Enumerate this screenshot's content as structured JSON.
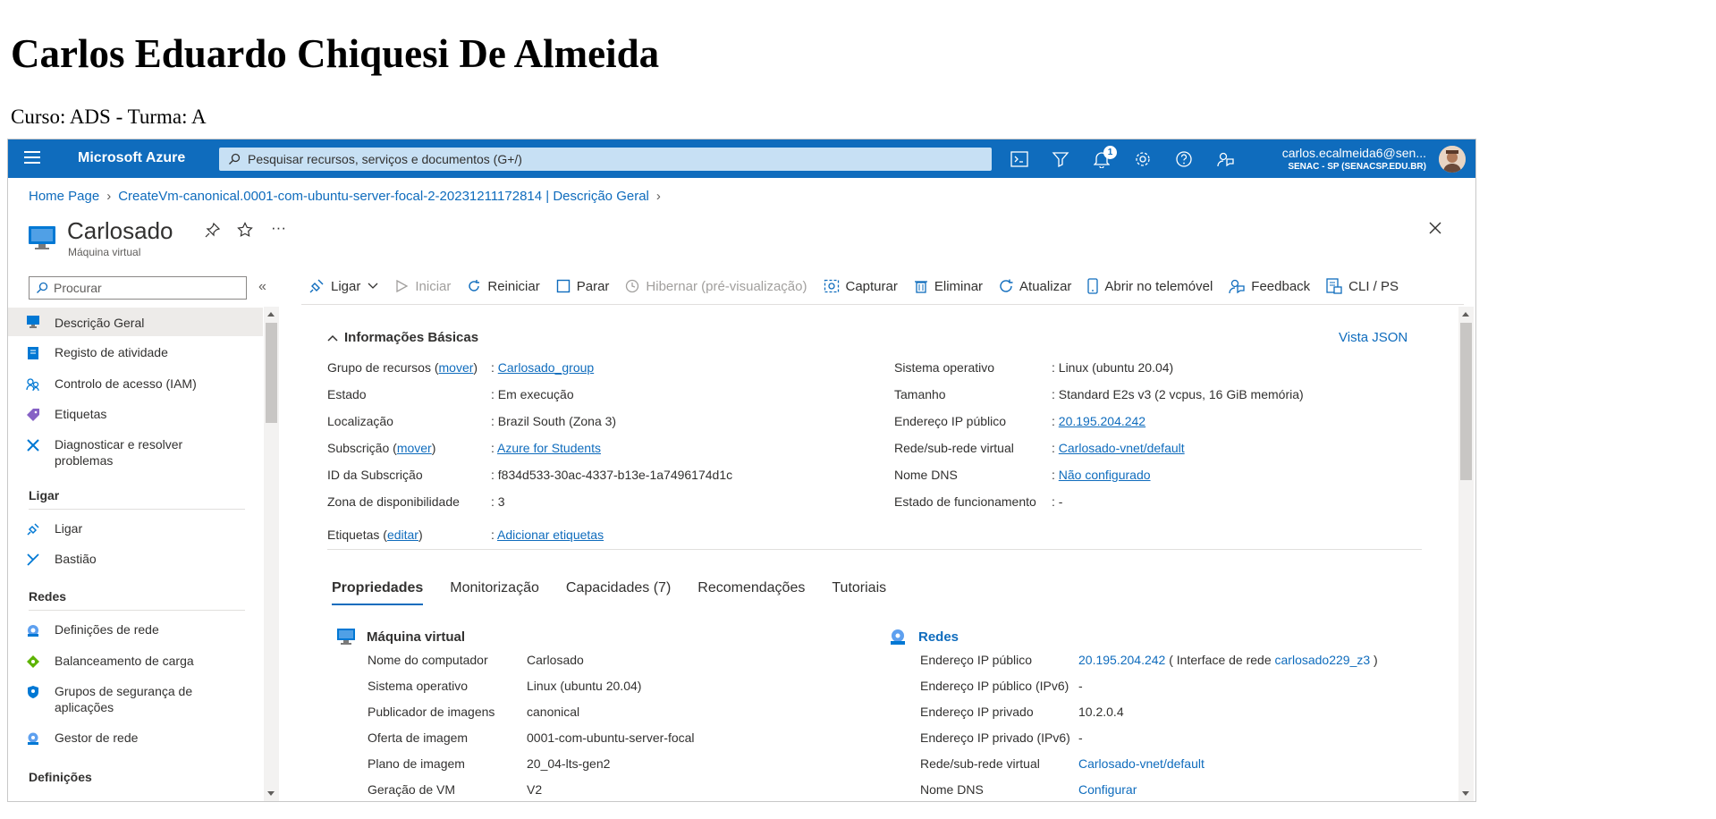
{
  "page": {
    "heading": "Carlos Eduardo Chiquesi De Almeida",
    "subheading": "Curso: ADS - Turma: A"
  },
  "topbar": {
    "brand": "Microsoft Azure",
    "search_placeholder": "Pesquisar recursos, serviços e documentos (G+/)",
    "notifications_count": "1",
    "account_email": "carlos.ecalmeida6@sen...",
    "account_tenant": "SENAC - SP (SENACSP.EDU.BR)"
  },
  "breadcrumb": {
    "items": [
      "Home Page",
      "CreateVm-canonical.0001-com-ubuntu-server-focal-2-20231211172814 | Descrição Geral"
    ]
  },
  "resource": {
    "name": "Carlosado",
    "type": "Máquina virtual"
  },
  "sidebar": {
    "search_placeholder": "Procurar",
    "items": [
      {
        "label": "Descrição Geral",
        "icon": "vm-monitor-icon",
        "active": true
      },
      {
        "label": "Registo de atividade",
        "icon": "activity-log-icon"
      },
      {
        "label": "Controlo de acesso (IAM)",
        "icon": "people-icon"
      },
      {
        "label": "Etiquetas",
        "icon": "tag-icon"
      },
      {
        "label": "Diagnosticar e resolver problemas",
        "icon": "wrench-icon"
      }
    ],
    "group_ligar": "Ligar",
    "ligar_items": [
      {
        "label": "Ligar",
        "icon": "plug-icon"
      },
      {
        "label": "Bastião",
        "icon": "bastion-icon"
      }
    ],
    "group_redes": "Redes",
    "redes_items": [
      {
        "label": "Definições de rede",
        "icon": "network-icon"
      },
      {
        "label": "Balanceamento de carga",
        "icon": "load-balancer-icon"
      },
      {
        "label": "Grupos de segurança de aplicações",
        "icon": "shield-icon"
      },
      {
        "label": "Gestor de rede",
        "icon": "network-manager-icon"
      }
    ],
    "group_definicoes": "Definições"
  },
  "commands": {
    "ligar": "Ligar",
    "iniciar": "Iniciar",
    "reiniciar": "Reiniciar",
    "parar": "Parar",
    "hibernar": "Hibernar (pré-visualização)",
    "capturar": "Capturar",
    "eliminar": "Eliminar",
    "atualizar": "Atualizar",
    "abrir": "Abrir no telemóvel",
    "feedback": "Feedback",
    "cli": "CLI / PS"
  },
  "essentials": {
    "toggle_label": "Informações Básicas",
    "json_link": "Vista JSON",
    "move_link": "mover",
    "edit_link": "editar",
    "left": {
      "grupo_label_pre": "Grupo de recursos (",
      "grupo_label_post": ")",
      "grupo_value": "Carlosado_group",
      "estado_label": "Estado",
      "estado_value": "Em execução",
      "localizacao_label": "Localização",
      "localizacao_value": "Brazil South (Zona 3)",
      "subscricao_label_pre": "Subscrição (",
      "subscricao_label_post": ")",
      "subscricao_value": "Azure for Students",
      "id_label": "ID da Subscrição",
      "id_value": "f834d533-30ac-4337-b13e-1a7496174d1c",
      "zona_label": "Zona de disponibilidade",
      "zona_value": "3"
    },
    "right": {
      "so_label": "Sistema operativo",
      "so_value": "Linux (ubuntu 20.04)",
      "tamanho_label": "Tamanho",
      "tamanho_value": "Standard E2s v3 (2 vcpus, 16 GiB memória)",
      "ip_label": "Endereço IP público",
      "ip_value": "20.195.204.242",
      "vnet_label": "Rede/sub-rede virtual",
      "vnet_value": "Carlosado-vnet/default",
      "dns_label": "Nome DNS",
      "dns_value": "Não configurado",
      "health_label": "Estado de funcionamento",
      "health_value": "-"
    },
    "tags_label_pre": "Etiquetas (",
    "tags_label_post": ")",
    "tags_value": "Adicionar etiquetas"
  },
  "tabs": [
    "Propriedades",
    "Monitorização",
    "Capacidades (7)",
    "Recomendações",
    "Tutoriais"
  ],
  "vm_section": {
    "title": "Máquina virtual",
    "rows": [
      {
        "label": "Nome do computador",
        "value": "Carlosado"
      },
      {
        "label": "Sistema operativo",
        "value": "Linux (ubuntu 20.04)"
      },
      {
        "label": "Publicador de imagens",
        "value": "canonical"
      },
      {
        "label": "Oferta de imagem",
        "value": "0001-com-ubuntu-server-focal"
      },
      {
        "label": "Plano de imagem",
        "value": "20_04-lts-gen2"
      },
      {
        "label": "Geração de VM",
        "value": "V2"
      }
    ]
  },
  "net_section": {
    "title": "Redes",
    "ip_label": "Endereço IP público",
    "ip_value": "20.195.204.242",
    "ip_iface_pre": "( Interface de rede",
    "ip_iface_link": "carlosado229_z3",
    "ip_iface_post": ")",
    "ipv6_label": "Endereço IP público (IPv6)",
    "ipv6_value": "-",
    "priv_label": "Endereço IP privado",
    "priv_value": "10.2.0.4",
    "privv6_label": "Endereço IP privado (IPv6)",
    "privv6_value": "-",
    "vnet_label": "Rede/sub-rede virtual",
    "vnet_value": "Carlosado-vnet/default",
    "dns_label": "Nome DNS",
    "dns_value": "Configurar"
  },
  "colors": {
    "accent": "#0f6cbd",
    "topbar": "#0f6cbd",
    "search": "#c7e0f4"
  }
}
